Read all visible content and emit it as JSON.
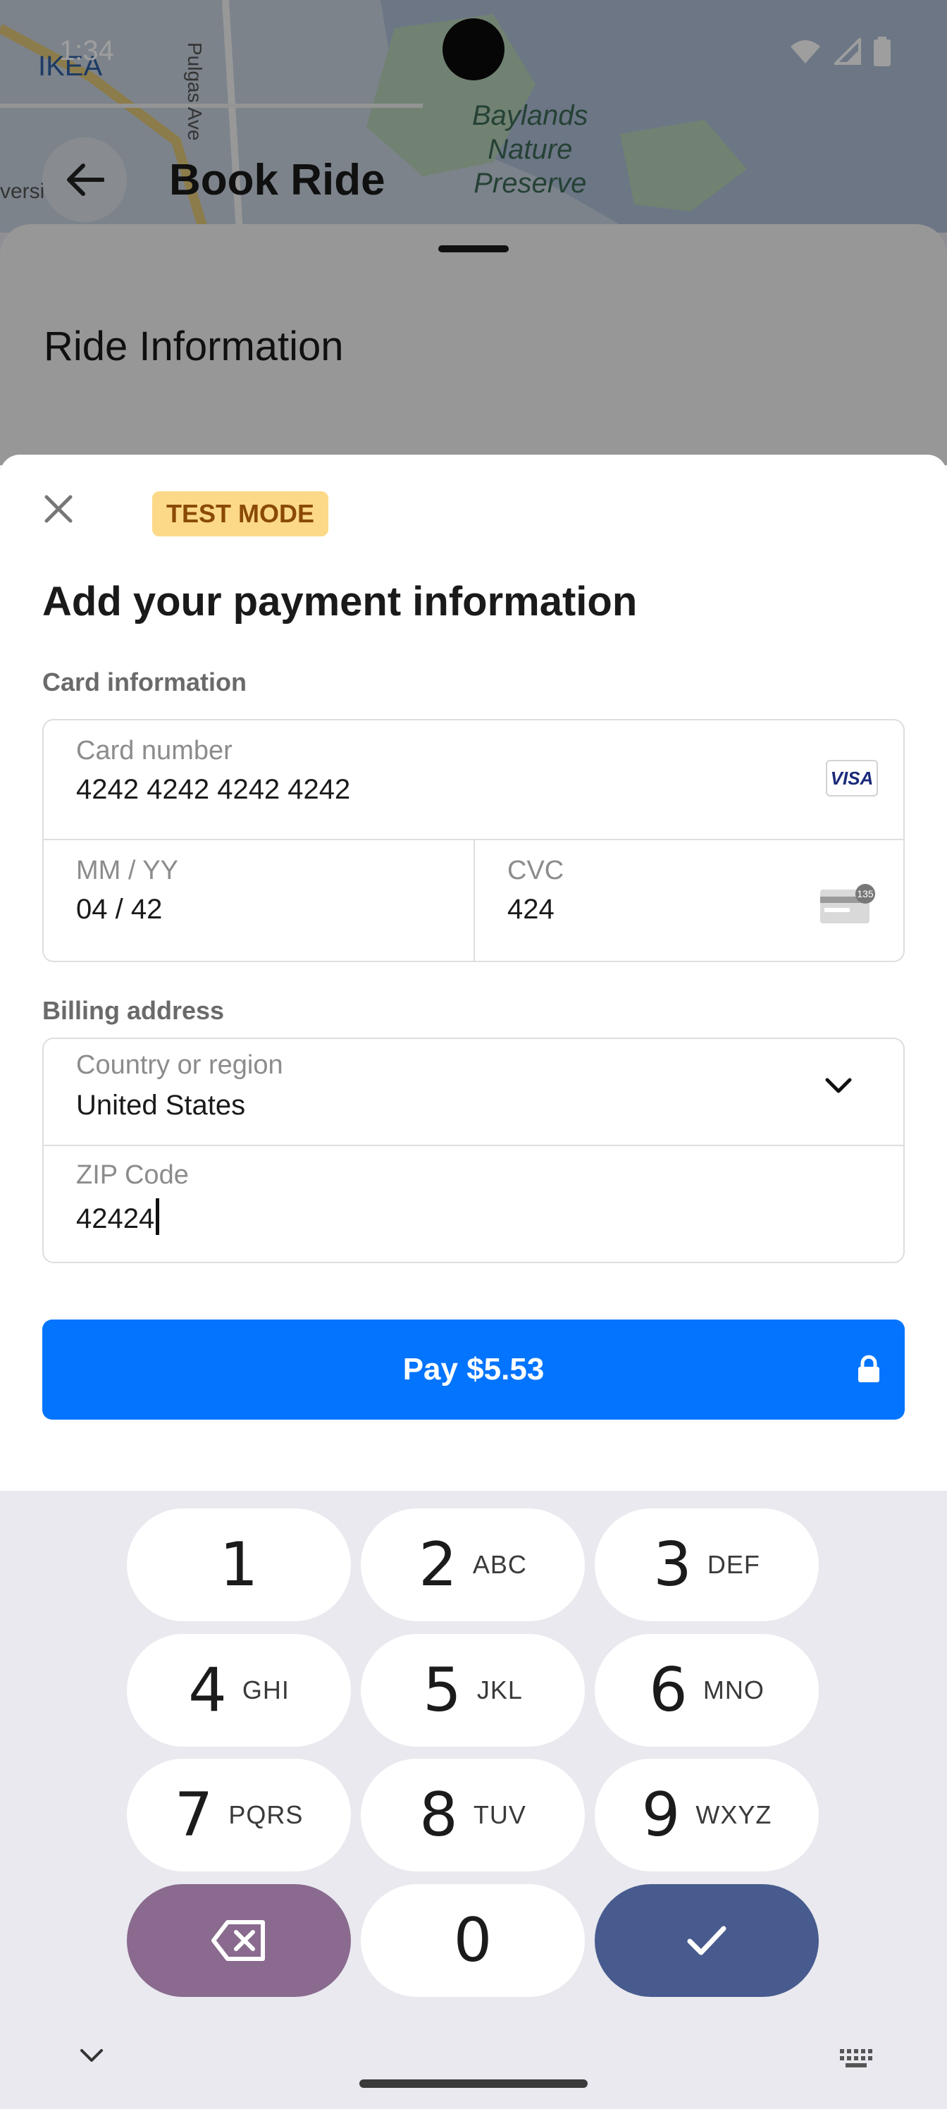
{
  "status_bar": {
    "time": "1:34"
  },
  "background": {
    "title": "Book Ride",
    "section_heading": "Ride Information",
    "map_labels": [
      "IKEA",
      "Pulgas Ave",
      "Baylands\nNature\nPreserve",
      "versi"
    ]
  },
  "payment_sheet": {
    "badge": "TEST MODE",
    "title": "Add your payment information",
    "card_section_label": "Card information",
    "card_number": {
      "label": "Card number",
      "value": "4242 4242 4242 4242",
      "brand": "VISA"
    },
    "expiry": {
      "label": "MM / YY",
      "value": "04 / 42"
    },
    "cvc": {
      "label": "CVC",
      "value": "424",
      "badge": "135"
    },
    "billing_section_label": "Billing address",
    "country": {
      "label": "Country or region",
      "value": "United States"
    },
    "zip": {
      "label": "ZIP Code",
      "value": "42424"
    },
    "pay_button": "Pay $5.53"
  },
  "keyboard": {
    "keys": [
      {
        "num": "1",
        "letters": ""
      },
      {
        "num": "2",
        "letters": "ABC"
      },
      {
        "num": "3",
        "letters": "DEF"
      },
      {
        "num": "4",
        "letters": "GHI"
      },
      {
        "num": "5",
        "letters": "JKL"
      },
      {
        "num": "6",
        "letters": "MNO"
      },
      {
        "num": "7",
        "letters": "PQRS"
      },
      {
        "num": "8",
        "letters": "TUV"
      },
      {
        "num": "9",
        "letters": "WXYZ"
      },
      {
        "num": "0",
        "letters": ""
      }
    ]
  },
  "colors": {
    "accent": "#0374fe",
    "badge_bg": "#fcd988",
    "badge_text": "#8a4a06",
    "delete_key": "#8a6a8e",
    "confirm_key": "#485b8f"
  },
  "icons": [
    "back-arrow-icon",
    "close-icon",
    "visa-icon",
    "cvc-card-icon",
    "chevron-down-icon",
    "lock-icon",
    "backspace-icon",
    "check-icon",
    "keyboard-hide-icon",
    "keyboard-switch-icon",
    "wifi-icon",
    "signal-icon",
    "battery-icon"
  ]
}
